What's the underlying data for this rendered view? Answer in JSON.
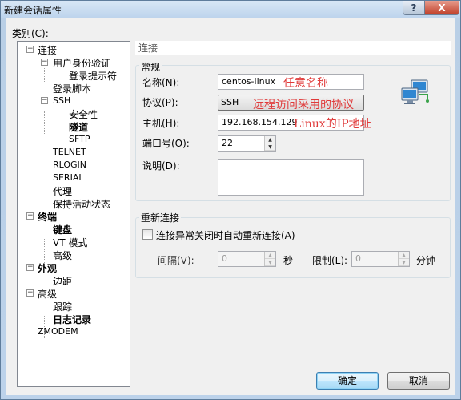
{
  "window": {
    "title": "新建会话属性",
    "help": "?",
    "close": "X"
  },
  "category_label": "类别(C):",
  "tree": [
    {
      "label": "连接",
      "bold": true,
      "expander": "−"
    },
    {
      "label": "用户身份验证",
      "bold": true,
      "expander": "−"
    },
    {
      "label": "登录提示符",
      "bold": false
    },
    {
      "label": "登录脚本",
      "bold": false
    },
    {
      "label": "SSH",
      "bold": false,
      "small": true,
      "expander": "−"
    },
    {
      "label": "安全性",
      "bold": false
    },
    {
      "label": "隧道",
      "bold": true
    },
    {
      "label": "SFTP",
      "bold": false,
      "small": true
    },
    {
      "label": "TELNET",
      "bold": false,
      "small": true
    },
    {
      "label": "RLOGIN",
      "bold": false,
      "small": true
    },
    {
      "label": "SERIAL",
      "bold": false,
      "small": true
    },
    {
      "label": "代理",
      "bold": false
    },
    {
      "label": "保持活动状态",
      "bold": false
    },
    {
      "label": "终端",
      "bold": true,
      "expander": "−"
    },
    {
      "label": "键盘",
      "bold": true
    },
    {
      "label": "VT 模式",
      "bold": false
    },
    {
      "label": "高级",
      "bold": false
    },
    {
      "label": "外观",
      "bold": true,
      "expander": "−"
    },
    {
      "label": "边距",
      "bold": false
    },
    {
      "label": "高级",
      "bold": false,
      "expander": "−"
    },
    {
      "label": "跟踪",
      "bold": false
    },
    {
      "label": "日志记录",
      "bold": true
    },
    {
      "label": "ZMODEM",
      "bold": false,
      "small": true
    }
  ],
  "section_header": "连接",
  "general": {
    "title": "常规",
    "name_label": "名称(N):",
    "name_value": "centos-linux",
    "protocol_label": "协议(P):",
    "protocol_value": "SSH",
    "host_label": "主机(H):",
    "host_value": "192.168.154.129",
    "port_label": "端口号(O):",
    "port_value": "22",
    "desc_label": "说明(D):",
    "desc_value": ""
  },
  "annotations": {
    "name": "任意名称",
    "protocol": "远程访问采用的协议",
    "host": "Linux的IP地址"
  },
  "reconnect": {
    "title": "重新连接",
    "checkbox_label": "连接异常关闭时自动重新连接(A)",
    "checked": false,
    "interval_label": "间隔(V):",
    "interval_value": "0",
    "interval_unit": "秒",
    "limit_label": "限制(L):",
    "limit_value": "0",
    "limit_unit": "分钟"
  },
  "buttons": {
    "ok": "确定",
    "cancel": "取消"
  },
  "icons": {
    "computer": "network-computers-icon",
    "expander": "tree-expander-icon",
    "spin_up": "spin-up-icon",
    "spin_down": "spin-down-icon"
  },
  "colors": {
    "annotation": "#e03a3a",
    "titlebar": "#bcd3ec",
    "close_button": "#c0402a"
  }
}
